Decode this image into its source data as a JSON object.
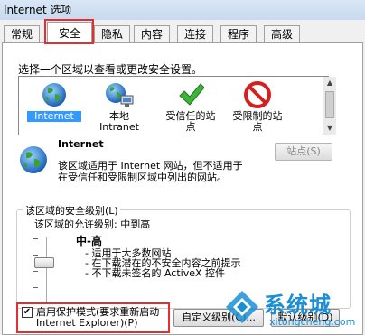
{
  "window": {
    "title": "Internet 选项"
  },
  "tabs": [
    {
      "label": "常规",
      "active": false
    },
    {
      "label": "安全",
      "active": true
    },
    {
      "label": "隐私",
      "active": false
    },
    {
      "label": "内容",
      "active": false
    },
    {
      "label": "连接",
      "active": false
    },
    {
      "label": "程序",
      "active": false
    },
    {
      "label": "高级",
      "active": false
    }
  ],
  "security": {
    "prompt": "选择一个区域以查看或更改安全设置。",
    "zones": [
      {
        "label_line1": "Internet",
        "label_line2": "",
        "icon": "globe-icon",
        "selected": true
      },
      {
        "label_line1": "本地",
        "label_line2": "Intranet",
        "icon": "network-globe-icon",
        "selected": false
      },
      {
        "label_line1": "受信任的站",
        "label_line2": "点",
        "icon": "checkmark-icon",
        "selected": false
      },
      {
        "label_line1": "受限制的站",
        "label_line2": "点",
        "icon": "no-entry-icon",
        "selected": false
      }
    ],
    "selected_zone_title": "Internet",
    "selected_zone_desc_1": "该区域适用于 Internet 网站，但不适用于",
    "selected_zone_desc_2": "在受信任和受限制区域中列出的网站。",
    "sites_button": "站点(S)",
    "level_group_title": "该区域的安全级别(L)",
    "allowed_levels": "该区域的允许级别: 中到高",
    "level_name": "中-高",
    "level_bullets": [
      "- 适用于大多数网站",
      "- 在下载潜在的不安全内容之前提示",
      "- 不下载未签名的 ActiveX 控件"
    ],
    "protected_mode_line1": "启用保护模式(要求重新启动",
    "protected_mode_line2": "Internet Explorer)(P)",
    "protected_mode_checked": true,
    "custom_level_button": "自定义级别(C)...",
    "default_level_button": "默认级别(D)"
  },
  "watermark": {
    "brand": "系统城",
    "url": "xitongcheng.com"
  },
  "colors": {
    "highlight": "#e23030",
    "selection": "#3399ff",
    "watermark": "#1a8fd6"
  }
}
